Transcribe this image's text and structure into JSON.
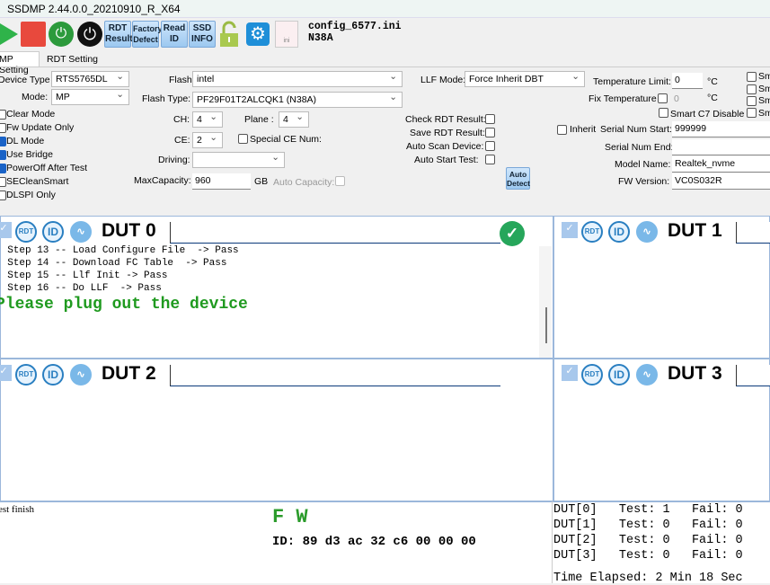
{
  "window": {
    "title": "SSDMP 2.44.0.0_20210910_R_X64"
  },
  "toolbar": {
    "rdt_result": "RDT Result",
    "factory_defect": "Factory Defect",
    "read_id": "Read ID",
    "ssd_info": "SSD INFO",
    "config_file": "config_6577.ini",
    "config_name": "N38A",
    "file_icon_text": "ini"
  },
  "tabs": [
    {
      "label": "MP Setting"
    },
    {
      "label": "RDT Setting"
    }
  ],
  "settings": {
    "device_type_label": "Device Type",
    "device_type": "RTS5765DL",
    "mode_label": "Mode:",
    "mode": "MP",
    "flash_label": "Flash",
    "flash": "intel",
    "flash_type_label": "Flash Type:",
    "flash_type": "PF29F01T2ALCQK1 (N38A)",
    "ch_label": "CH:",
    "ch": "4",
    "plane_label": "Plane :",
    "plane": "4",
    "ce_label": "CE:",
    "ce": "2",
    "special_ce_label": "Special CE Num:",
    "driving_label": "Driving:",
    "driving": "",
    "max_capacity_label": "MaxCapacity:",
    "max_capacity": "960",
    "gb": "GB",
    "auto_capacity_label": "Auto Capacity:",
    "checks": [
      {
        "label": "Clear Mode",
        "on": false
      },
      {
        "label": "Fw Update Only",
        "on": false
      },
      {
        "label": "DL Mode",
        "on": true
      },
      {
        "label": "Use Bridge",
        "on": true
      },
      {
        "label": "PowerOff After Test",
        "on": true
      },
      {
        "label": "SECleanSmart",
        "on": false
      },
      {
        "label": "DLSPI Only",
        "on": false
      }
    ],
    "llf_mode_label": "LLF Mode:",
    "llf_mode": "Force Inherit DBT",
    "check_rdt": "Check RDT Result:",
    "save_rdt": "Save RDT Result:",
    "auto_scan": "Auto Scan Device:",
    "auto_start": "Auto Start Test:",
    "auto_detect": "Auto Detect",
    "temp_limit_label": "Temperature Limit:",
    "temp_limit": "0",
    "celsius": "°C",
    "fix_temp_label": "Fix Temperature",
    "fix_temp": "0",
    "smart_c7": "Smart C7 Disable",
    "sm": [
      "Sm",
      "Sm",
      "Sm",
      "Sm"
    ],
    "inherit_label": "Inherit",
    "serial_start_label": "Serial Num Start:",
    "serial_start": "999999",
    "serial_end_label": "Serial Num End:",
    "serial_end": "",
    "model_name_label": "Model Name:",
    "model_name": "Realtek_nvme",
    "fw_version_label": "FW Version:",
    "fw_version": "VC0S032R"
  },
  "duts": [
    {
      "label": "DUT 0",
      "log": [
        "- Step 13 -- Load Configure File  -> Pass",
        "- Step 14 -- Download FC Table  -> Pass",
        "- Step 15 -- Llf Init -> Pass",
        "- Step 16 -- Do LLF  -> Pass"
      ],
      "message": "Please plug out the device",
      "status": "pass"
    },
    {
      "label": "DUT 1"
    },
    {
      "label": "DUT 2"
    },
    {
      "label": "DUT 3"
    }
  ],
  "icons": {
    "rdt": "RDT",
    "id": "ID"
  },
  "bottom": {
    "status": "Test finish",
    "fw": "F W",
    "id": "ID: 89 d3 ac 32 c6 00 00 00",
    "stats": [
      {
        "dut": "DUT[0]",
        "test": "Test: 1",
        "fail": "Fail: 0"
      },
      {
        "dut": "DUT[1]",
        "test": "Test: 0",
        "fail": "Fail: 0"
      },
      {
        "dut": "DUT[2]",
        "test": "Test: 0",
        "fail": "Fail: 0"
      },
      {
        "dut": "DUT[3]",
        "test": "Test: 0",
        "fail": "Fail: 0"
      }
    ],
    "elapsed": "Time Elapsed: 2 Min 18 Sec"
  }
}
